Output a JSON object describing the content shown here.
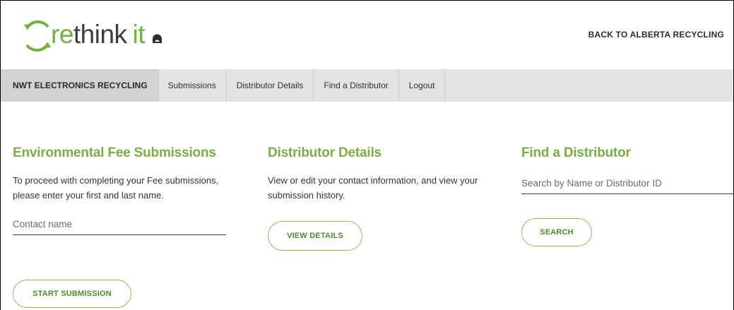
{
  "header": {
    "logo": {
      "re": "re",
      "think": "think",
      "it": "it"
    },
    "back_link": "BACK TO ALBERTA RECYCLING"
  },
  "nav": {
    "items": [
      {
        "label": "NWT ELECTRONICS RECYCLING",
        "active": true
      },
      {
        "label": "Submissions"
      },
      {
        "label": "Distributor Details"
      },
      {
        "label": "Find a Distributor"
      },
      {
        "label": "Logout"
      }
    ]
  },
  "fee_submissions": {
    "title": "Environmental Fee Submissions",
    "description": "To proceed with completing your Fee submissions, please enter your first and last name.",
    "contact_placeholder": "Contact name",
    "contact_value": "",
    "button_label": "START SUBMISSION"
  },
  "distributor_details": {
    "title": "Distributor Details",
    "description": "View or edit your contact information, and view your submission history.",
    "button_label": "VIEW DETAILS"
  },
  "find_distributor": {
    "title": "Find a Distributor",
    "search_placeholder": "Search by Name or Distributor ID",
    "search_value": "",
    "button_label": "SEARCH"
  },
  "colors": {
    "brand_green": "#78b043",
    "button_border": "#8fbe5d",
    "nav_background": "#e3e3e3",
    "nav_active_background": "#d2d2d2"
  },
  "icons": {
    "logo_mark": "recycle-arrows-icon",
    "logo_badge": "bear-badge-icon"
  }
}
